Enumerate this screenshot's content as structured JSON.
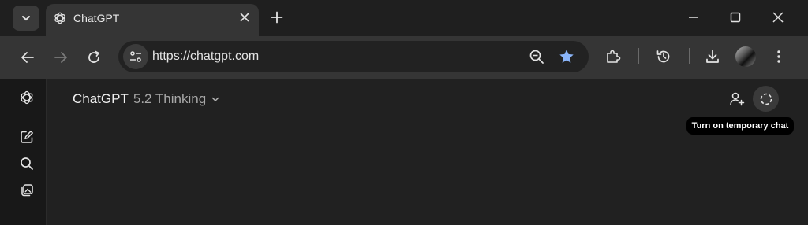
{
  "browser": {
    "tab": {
      "title": "ChatGPT"
    },
    "address_bar": {
      "url": "https://chatgpt.com"
    }
  },
  "app": {
    "model_switcher": {
      "brand": "ChatGPT",
      "model": "5.2 Thinking"
    },
    "tooltip": {
      "text": "Turn on temporary chat"
    }
  },
  "colors": {
    "bookmark_star": "#8ab4f8",
    "accent_text": "#e3e3e3"
  },
  "icons": {
    "tab_search": "chevron-down-icon",
    "favicon": "openai-logo-icon",
    "bookmark": "star-icon",
    "zoom": "zoom-out-icon"
  }
}
